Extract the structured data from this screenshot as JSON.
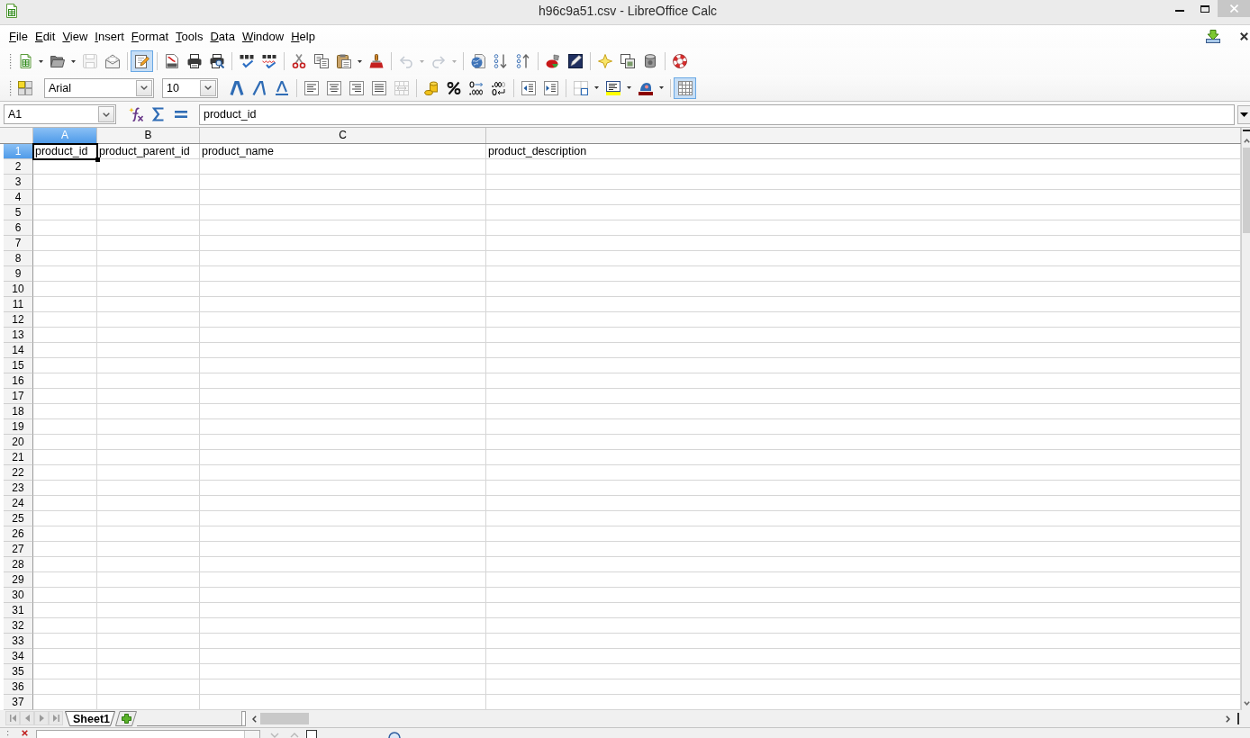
{
  "window": {
    "title": "h96c9a51.csv - LibreOffice Calc"
  },
  "menu_bar": {
    "items": [
      "File",
      "Edit",
      "View",
      "Insert",
      "Format",
      "Tools",
      "Data",
      "Window",
      "Help"
    ]
  },
  "standard_toolbar": {
    "groups": [
      [
        {
          "kind": "split",
          "selected": false,
          "disabled": false
        },
        {
          "kind": "split",
          "selected": false,
          "disabled": false
        },
        {
          "kind": "button",
          "selected": false,
          "disabled": true
        },
        {
          "kind": "button",
          "selected": false,
          "disabled": false
        }
      ],
      [
        {
          "kind": "button",
          "selected": true,
          "disabled": false
        }
      ],
      [
        {
          "kind": "button",
          "selected": false,
          "disabled": false
        },
        {
          "kind": "button",
          "selected": false,
          "disabled": false
        },
        {
          "kind": "button",
          "selected": false,
          "disabled": false
        }
      ],
      [
        {
          "kind": "button",
          "selected": false,
          "disabled": false
        },
        {
          "kind": "button",
          "selected": false,
          "disabled": false
        }
      ],
      [
        {
          "kind": "button",
          "selected": false,
          "disabled": false
        },
        {
          "kind": "button",
          "selected": false,
          "disabled": false
        },
        {
          "kind": "split",
          "selected": false,
          "disabled": false
        },
        {
          "kind": "button",
          "selected": false,
          "disabled": false
        }
      ],
      [
        {
          "kind": "split",
          "selected": false,
          "disabled": true
        },
        {
          "kind": "split",
          "selected": false,
          "disabled": true
        }
      ],
      [
        {
          "kind": "button",
          "selected": false,
          "disabled": false
        },
        {
          "kind": "button",
          "selected": false,
          "disabled": false
        },
        {
          "kind": "button",
          "selected": false,
          "disabled": false
        }
      ],
      [
        {
          "kind": "button",
          "selected": false,
          "disabled": false
        },
        {
          "kind": "button",
          "selected": false,
          "disabled": false
        }
      ],
      [
        {
          "kind": "button",
          "selected": false,
          "disabled": false
        },
        {
          "kind": "button",
          "selected": false,
          "disabled": false
        },
        {
          "kind": "button",
          "selected": false,
          "disabled": false
        }
      ],
      [
        {
          "kind": "button",
          "selected": false,
          "disabled": false
        }
      ]
    ]
  },
  "formatting_toolbar": {
    "styles_button": {
      "kind": "button",
      "selected": false,
      "disabled": false
    },
    "font_name": "Arial",
    "font_size": "10",
    "groups": [
      [
        {
          "kind": "button",
          "selected": false,
          "disabled": false
        },
        {
          "kind": "button",
          "selected": false,
          "disabled": false
        },
        {
          "kind": "button",
          "selected": false,
          "disabled": false
        }
      ],
      [
        {
          "kind": "button",
          "selected": false,
          "disabled": false
        },
        {
          "kind": "button",
          "selected": false,
          "disabled": false
        },
        {
          "kind": "button",
          "selected": false,
          "disabled": false
        },
        {
          "kind": "button",
          "selected": false,
          "disabled": false
        },
        {
          "kind": "button",
          "selected": false,
          "disabled": true
        }
      ],
      [
        {
          "kind": "button",
          "selected": false,
          "disabled": false
        },
        {
          "kind": "button",
          "selected": false,
          "disabled": false
        },
        {
          "kind": "button",
          "selected": false,
          "disabled": false
        },
        {
          "kind": "button",
          "selected": false,
          "disabled": false
        }
      ],
      [
        {
          "kind": "button",
          "selected": false,
          "disabled": false
        },
        {
          "kind": "button",
          "selected": false,
          "disabled": false
        }
      ],
      [
        {
          "kind": "split",
          "selected": false,
          "disabled": false
        },
        {
          "kind": "split",
          "selected": false,
          "disabled": false
        },
        {
          "kind": "split",
          "selected": false,
          "disabled": false
        }
      ],
      [
        {
          "kind": "button",
          "selected": true,
          "disabled": false
        }
      ]
    ]
  },
  "formula_bar": {
    "name_box": "A1",
    "content": "product_id"
  },
  "sheet": {
    "columns": [
      {
        "label": "A",
        "selected": true
      },
      {
        "label": "B",
        "selected": false
      },
      {
        "label": "C",
        "selected": false
      },
      {
        "selected": false
      }
    ],
    "rows": [
      {
        "number": "1",
        "selected": true,
        "cells": [
          {
            "text": "product_id",
            "active": true
          },
          {
            "text": "product_parent_id",
            "active": false
          },
          {
            "text": "product_name",
            "active": false
          },
          {
            "text": "product_description",
            "active": false
          }
        ]
      },
      {
        "number": "2",
        "selected": false
      },
      {
        "number": "3",
        "selected": false
      },
      {
        "number": "4",
        "selected": false
      },
      {
        "number": "5",
        "selected": false
      },
      {
        "number": "6",
        "selected": false
      },
      {
        "number": "7",
        "selected": false
      },
      {
        "number": "8",
        "selected": false
      },
      {
        "number": "9",
        "selected": false
      },
      {
        "number": "10",
        "selected": false
      },
      {
        "number": "11",
        "selected": false
      },
      {
        "number": "12",
        "selected": false
      },
      {
        "number": "13",
        "selected": false
      },
      {
        "number": "14",
        "selected": false
      },
      {
        "number": "15",
        "selected": false
      },
      {
        "number": "16",
        "selected": false
      },
      {
        "number": "17",
        "selected": false
      },
      {
        "number": "18",
        "selected": false
      },
      {
        "number": "19",
        "selected": false
      },
      {
        "number": "20",
        "selected": false
      },
      {
        "number": "21",
        "selected": false
      },
      {
        "number": "22",
        "selected": false
      },
      {
        "number": "23",
        "selected": false
      },
      {
        "number": "24",
        "selected": false
      },
      {
        "number": "25",
        "selected": false
      },
      {
        "number": "26",
        "selected": false
      },
      {
        "number": "27",
        "selected": false
      },
      {
        "number": "28",
        "selected": false
      },
      {
        "number": "29",
        "selected": false
      },
      {
        "number": "30",
        "selected": false
      },
      {
        "number": "31",
        "selected": false
      },
      {
        "number": "32",
        "selected": false
      },
      {
        "number": "33",
        "selected": false
      },
      {
        "number": "34",
        "selected": false
      },
      {
        "number": "35",
        "selected": false
      },
      {
        "number": "36",
        "selected": false
      },
      {
        "number": "37",
        "selected": false
      }
    ]
  },
  "sheet_tabs": [
    {
      "label": "Sheet1",
      "selected": true
    }
  ],
  "find_toolbar": {
    "match_case": {
      "checked": false
    }
  }
}
